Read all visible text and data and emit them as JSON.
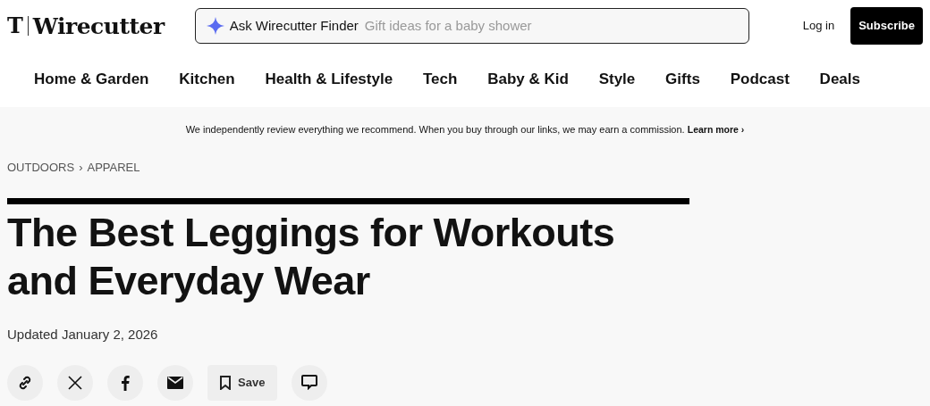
{
  "header": {
    "logo_mark": "T",
    "logo_text": "Wirecutter",
    "finder": {
      "label": "Ask Wirecutter Finder",
      "placeholder": "Gift ideas for a baby shower"
    },
    "login": "Log in",
    "subscribe": "Subscribe"
  },
  "nav": [
    "Home & Garden",
    "Kitchen",
    "Health & Lifestyle",
    "Tech",
    "Baby & Kid",
    "Style",
    "Gifts",
    "Podcast",
    "Deals"
  ],
  "disclosure": {
    "text": "We independently review everything we recommend. When you buy through our links, we may earn a commission.",
    "link": "Learn more ›"
  },
  "breadcrumb": [
    "OUTDOORS",
    "›",
    "APPAREL"
  ],
  "title": "The Best Leggings for Workouts and Everyday Wear",
  "updated": "Updated January 2, 2026",
  "share": [
    {
      "kind": "link"
    },
    {
      "kind": "x"
    },
    {
      "kind": "facebook"
    },
    {
      "kind": "email"
    },
    {
      "kind": "save",
      "label": "Save"
    },
    {
      "kind": "comment"
    }
  ]
}
